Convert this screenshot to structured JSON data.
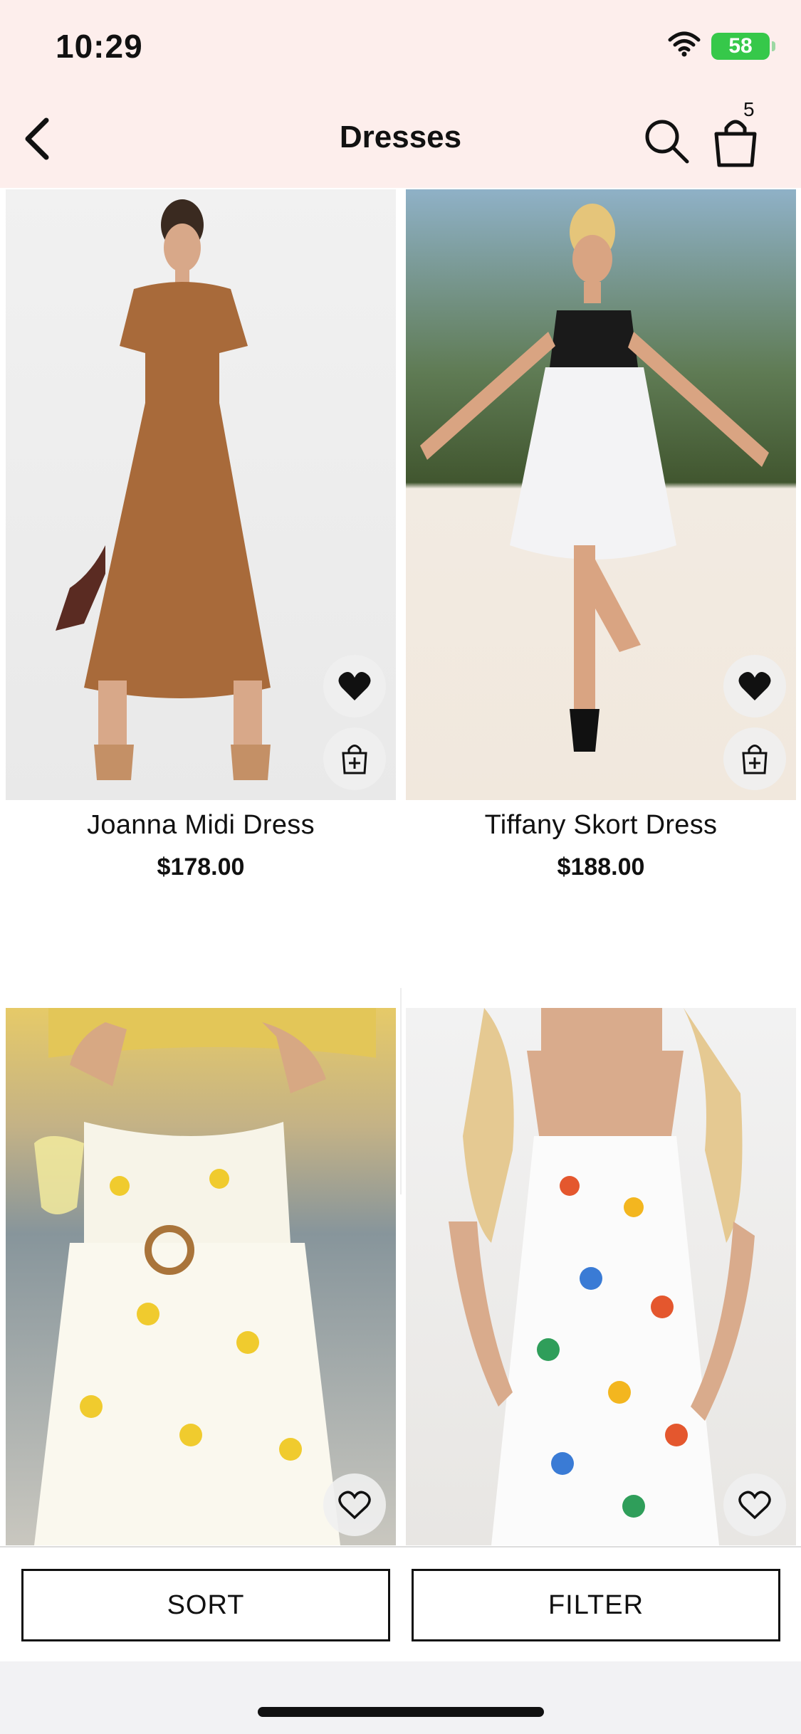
{
  "status_bar": {
    "time": "10:29",
    "battery": "58"
  },
  "nav": {
    "title": "Dresses",
    "cart_count": "5"
  },
  "products": [
    {
      "name": "Joanna Midi Dress",
      "price": "$178.00",
      "favorited": true
    },
    {
      "name": "Tiffany Skort Dress",
      "price": "$188.00",
      "favorited": true
    },
    {
      "name": "",
      "price": "",
      "favorited": false
    },
    {
      "name": "",
      "price": "",
      "favorited": false
    }
  ],
  "actions": {
    "sort_label": "SORT",
    "filter_label": "FILTER"
  },
  "colors": {
    "header_bg": "#fdeeec",
    "battery_green": "#36c84a",
    "text": "#111111"
  },
  "icons": [
    "back-chevron-icon",
    "search-icon",
    "shopping-bag-icon",
    "heart-icon",
    "add-to-bag-icon",
    "wifi-icon",
    "battery-icon"
  ]
}
